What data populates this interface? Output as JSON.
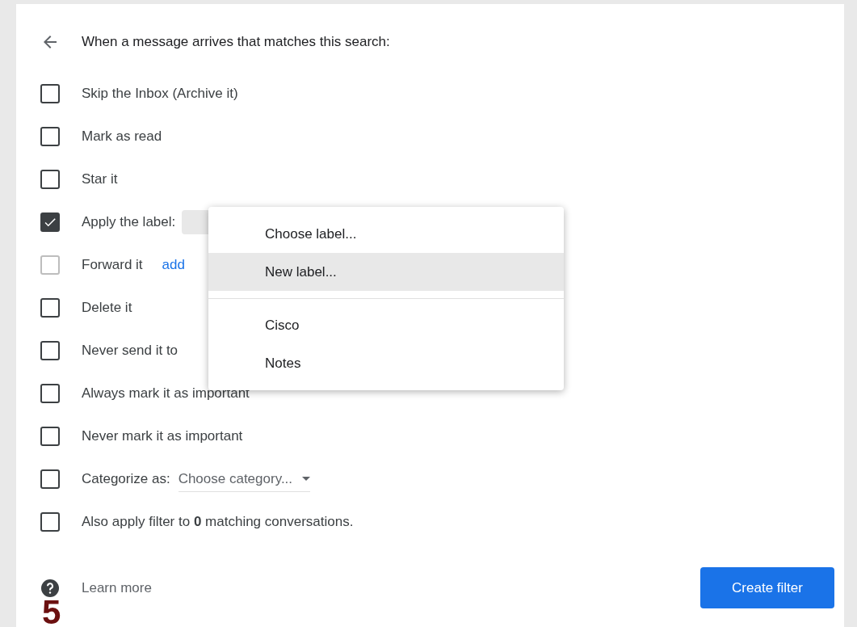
{
  "header": {
    "text": "When a message arrives that matches this search:"
  },
  "options": [
    {
      "kind": "plain",
      "label": "Skip the Inbox (Archive it)",
      "checked": false,
      "disabled": false
    },
    {
      "kind": "plain",
      "label": "Mark as read",
      "checked": false,
      "disabled": false
    },
    {
      "kind": "plain",
      "label": "Star it",
      "checked": false,
      "disabled": false
    },
    {
      "kind": "label_select",
      "label": "Apply the label:",
      "checked": true,
      "disabled": false
    },
    {
      "kind": "link",
      "label": "Forward it",
      "link": "add",
      "checked": false,
      "disabled": true
    },
    {
      "kind": "plain",
      "label": "Delete it",
      "checked": false,
      "disabled": false
    },
    {
      "kind": "plain",
      "label": "Never send it to",
      "checked": false,
      "disabled": false
    },
    {
      "kind": "plain",
      "label": "Always mark it as important",
      "checked": false,
      "disabled": false
    },
    {
      "kind": "plain",
      "label": "Never mark it as important",
      "checked": false,
      "disabled": false
    },
    {
      "kind": "category",
      "label": "Categorize as:",
      "value": "Choose category...",
      "checked": false,
      "disabled": false
    },
    {
      "kind": "rich",
      "label": "Also apply filter to **0** matching conversations.",
      "checked": false,
      "disabled": false
    }
  ],
  "label_menu": {
    "groups": [
      [
        {
          "label": "Choose label...",
          "selected": false
        },
        {
          "label": "New label...",
          "selected": true
        }
      ],
      [
        {
          "label": "Cisco",
          "selected": false
        },
        {
          "label": "Notes",
          "selected": false
        }
      ]
    ]
  },
  "footer": {
    "learn_more": "Learn more",
    "create_button": "Create filter"
  },
  "step_number": "5"
}
